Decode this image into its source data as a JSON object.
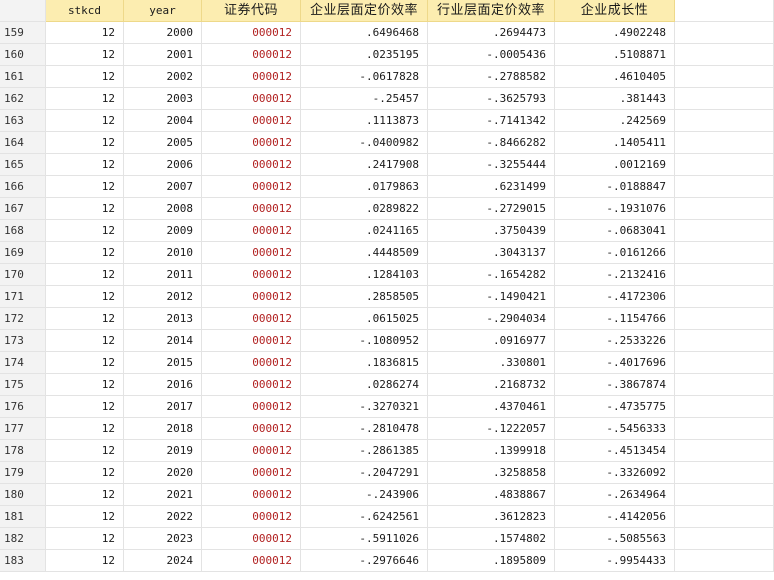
{
  "columns": [
    "",
    "stkcd",
    "year",
    "证券代码",
    "企业层面定价效率",
    "行业层面定价效率",
    "企业成长性"
  ],
  "rows": [
    [
      "159",
      "12",
      "2000",
      "000012",
      ".6496468",
      ".2694473",
      ".4902248"
    ],
    [
      "160",
      "12",
      "2001",
      "000012",
      ".0235195",
      "-.0005436",
      ".5108871"
    ],
    [
      "161",
      "12",
      "2002",
      "000012",
      "-.0617828",
      "-.2788582",
      ".4610405"
    ],
    [
      "162",
      "12",
      "2003",
      "000012",
      "-.25457",
      "-.3625793",
      ".381443"
    ],
    [
      "163",
      "12",
      "2004",
      "000012",
      ".1113873",
      "-.7141342",
      ".242569"
    ],
    [
      "164",
      "12",
      "2005",
      "000012",
      "-.0400982",
      "-.8466282",
      ".1405411"
    ],
    [
      "165",
      "12",
      "2006",
      "000012",
      ".2417908",
      "-.3255444",
      ".0012169"
    ],
    [
      "166",
      "12",
      "2007",
      "000012",
      ".0179863",
      ".6231499",
      "-.0188847"
    ],
    [
      "167",
      "12",
      "2008",
      "000012",
      ".0289822",
      "-.2729015",
      "-.1931076"
    ],
    [
      "168",
      "12",
      "2009",
      "000012",
      ".0241165",
      ".3750439",
      "-.0683041"
    ],
    [
      "169",
      "12",
      "2010",
      "000012",
      ".4448509",
      ".3043137",
      "-.0161266"
    ],
    [
      "170",
      "12",
      "2011",
      "000012",
      ".1284103",
      "-.1654282",
      "-.2132416"
    ],
    [
      "171",
      "12",
      "2012",
      "000012",
      ".2858505",
      "-.1490421",
      "-.4172306"
    ],
    [
      "172",
      "12",
      "2013",
      "000012",
      ".0615025",
      "-.2904034",
      "-.1154766"
    ],
    [
      "173",
      "12",
      "2014",
      "000012",
      "-.1080952",
      ".0916977",
      "-.2533226"
    ],
    [
      "174",
      "12",
      "2015",
      "000012",
      ".1836815",
      ".330801",
      "-.4017696"
    ],
    [
      "175",
      "12",
      "2016",
      "000012",
      ".0286274",
      ".2168732",
      "-.3867874"
    ],
    [
      "176",
      "12",
      "2017",
      "000012",
      "-.3270321",
      ".4370461",
      "-.4735775"
    ],
    [
      "177",
      "12",
      "2018",
      "000012",
      "-.2810478",
      "-.1222057",
      "-.5456333"
    ],
    [
      "178",
      "12",
      "2019",
      "000012",
      "-.2861385",
      ".1399918",
      "-.4513454"
    ],
    [
      "179",
      "12",
      "2020",
      "000012",
      "-.2047291",
      ".3258858",
      "-.3326092"
    ],
    [
      "180",
      "12",
      "2021",
      "000012",
      "-.243906",
      ".4838867",
      "-.2634964"
    ],
    [
      "181",
      "12",
      "2022",
      "000012",
      "-.6242561",
      ".3612823",
      "-.4142056"
    ],
    [
      "182",
      "12",
      "2023",
      "000012",
      "-.5911026",
      ".1574802",
      "-.5085563"
    ],
    [
      "183",
      "12",
      "2024",
      "000012",
      "-.2976646",
      ".1895809",
      "-.9954433"
    ]
  ]
}
